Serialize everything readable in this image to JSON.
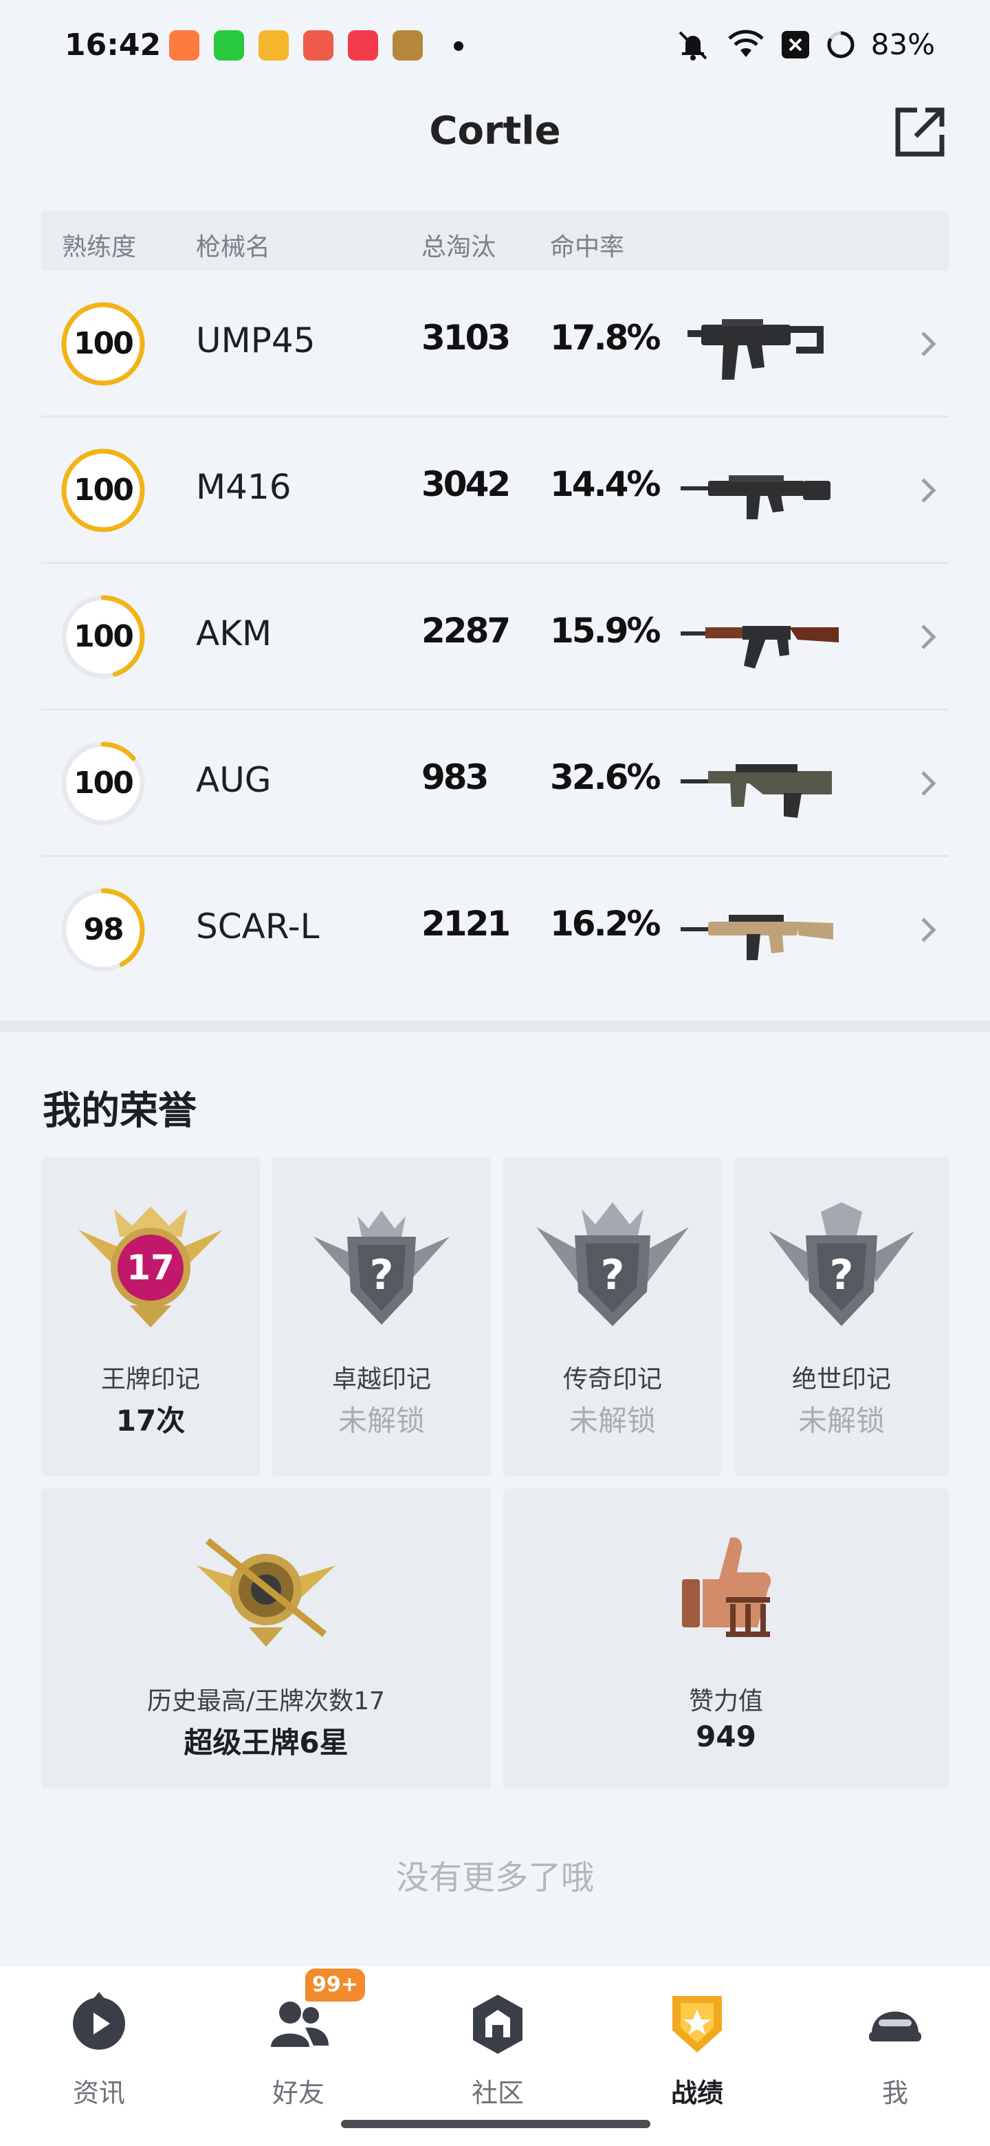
{
  "status_bar": {
    "time": "16:42",
    "battery": "83%",
    "icons": [
      "mute-icon",
      "wifi-icon",
      "sim-off-icon",
      "battery-ring-icon"
    ]
  },
  "header": {
    "title": "Cortle"
  },
  "table": {
    "columns": [
      "熟练度",
      "枪械名",
      "总淘汰",
      "命中率"
    ],
    "rows": [
      {
        "proficiency": "100",
        "progress": 1.0,
        "name": "UMP45",
        "kills": "3103",
        "accuracy": "17.8%",
        "gun_icon": "ump45-icon"
      },
      {
        "proficiency": "100",
        "progress": 1.0,
        "name": "M416",
        "kills": "3042",
        "accuracy": "14.4%",
        "gun_icon": "m416-icon"
      },
      {
        "proficiency": "100",
        "progress": 0.45,
        "name": "AKM",
        "kills": "2287",
        "accuracy": "15.9%",
        "gun_icon": "akm-icon"
      },
      {
        "proficiency": "100",
        "progress": 0.14,
        "name": "AUG",
        "kills": "983",
        "accuracy": "32.6%",
        "gun_icon": "aug-icon"
      },
      {
        "proficiency": "98",
        "progress": 0.42,
        "name": "SCAR-L",
        "kills": "2121",
        "accuracy": "16.2%",
        "gun_icon": "scar-l-icon"
      }
    ]
  },
  "honors": {
    "title": "我的荣誉",
    "badges": [
      {
        "name": "王牌印记",
        "value": "17次",
        "locked": false,
        "emblem_number": "17",
        "icon": "ace-mark-icon"
      },
      {
        "name": "卓越印记",
        "value": "未解锁",
        "locked": true,
        "emblem_number": "?",
        "icon": "excellence-mark-icon"
      },
      {
        "name": "传奇印记",
        "value": "未解锁",
        "locked": true,
        "emblem_number": "?",
        "icon": "legend-mark-icon"
      },
      {
        "name": "绝世印记",
        "value": "未解锁",
        "locked": true,
        "emblem_number": "?",
        "icon": "peerless-mark-icon"
      }
    ],
    "highest": {
      "label": "历史最高/王牌次数17",
      "value": "超级王牌6星",
      "icon": "super-ace-emblem-icon"
    },
    "likes": {
      "label": "赞力值",
      "value": "949",
      "icon": "thumbs-up-icon"
    }
  },
  "footer_note": "没有更多了哦",
  "bottom_nav": {
    "items": [
      {
        "label": "资讯",
        "icon": "news-icon",
        "active": false
      },
      {
        "label": "好友",
        "icon": "friends-icon",
        "active": false
      },
      {
        "label": "社区",
        "icon": "community-icon",
        "active": false
      },
      {
        "label": "战绩",
        "icon": "record-icon",
        "active": true
      },
      {
        "label": "我",
        "icon": "me-icon",
        "active": false
      }
    ],
    "friends_badge": "99+"
  },
  "colors": {
    "ring_progress": "#f2b316",
    "ring_track": "#e7e9ee",
    "accent_orange": "#f28b2c",
    "page_bg": "#f1f4f9"
  }
}
